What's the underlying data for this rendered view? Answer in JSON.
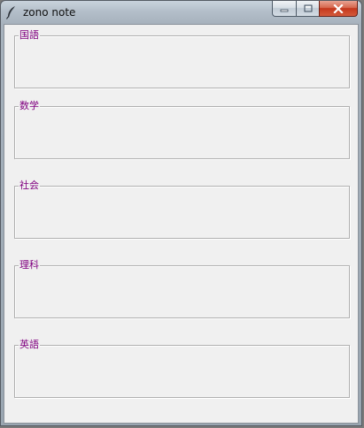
{
  "window": {
    "title": "zono note"
  },
  "caption_buttons": {
    "minimize": "minimize-icon",
    "maximize": "maximize-icon",
    "close": "close-icon"
  },
  "groups": [
    {
      "label": "国語"
    },
    {
      "label": "数学"
    },
    {
      "label": "社会"
    },
    {
      "label": "理科"
    },
    {
      "label": "英語"
    }
  ],
  "colors": {
    "label": "#800080",
    "client_bg": "#f0f0f0",
    "close_button": "#c4371c"
  }
}
